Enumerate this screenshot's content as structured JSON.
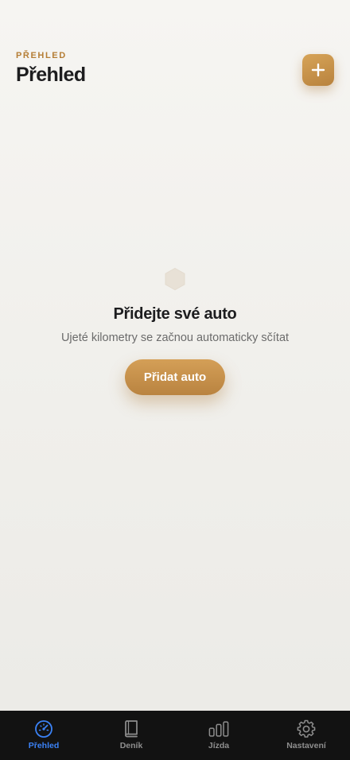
{
  "header": {
    "eyebrow": "PŘEHLED",
    "title": "Přehled",
    "add_icon": "plus-icon"
  },
  "empty_state": {
    "icon": "hexagon-icon",
    "title": "Přidejte své auto",
    "subtitle": "Ujeté kilometry se začnou automaticky sčítat",
    "button_label": "Přidat auto"
  },
  "tabbar": {
    "active_color": "#3b82f6",
    "inactive_color": "#8e8e8e",
    "items": [
      {
        "label": "Přehled",
        "icon": "speedometer-icon",
        "active": true
      },
      {
        "label": "Deník",
        "icon": "book-icon",
        "active": false
      },
      {
        "label": "Jízda",
        "icon": "bar-chart-icon",
        "active": false
      },
      {
        "label": "Nastavení",
        "icon": "gear-icon",
        "active": false
      }
    ]
  },
  "colors": {
    "accent": "#c08a45",
    "background": "#f3f2ee",
    "tabbar_bg": "#121212"
  }
}
